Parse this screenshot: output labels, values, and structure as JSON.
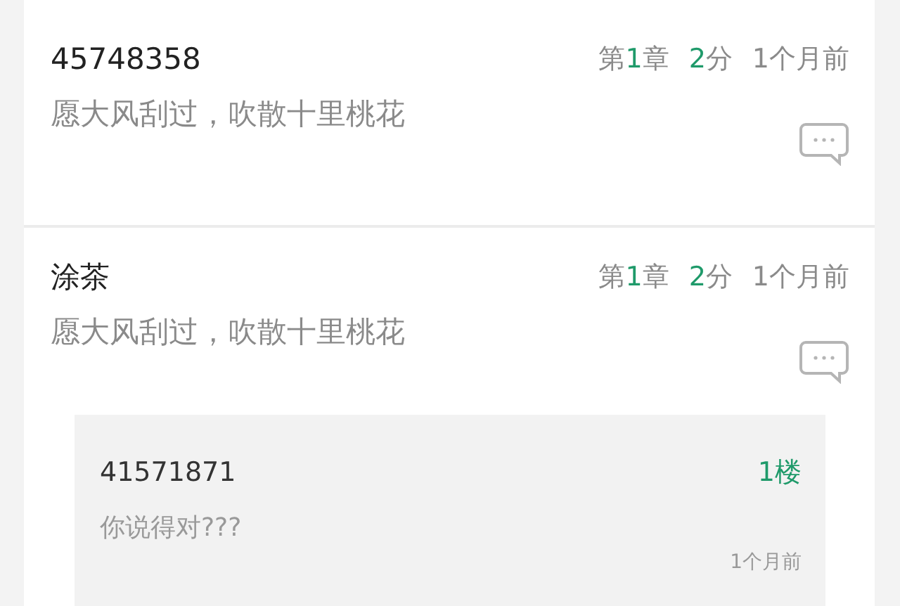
{
  "comments": [
    {
      "user": "45748358",
      "chapter": {
        "before": "第",
        "number": "1",
        "after": "章"
      },
      "score": {
        "number": "2",
        "after": "分"
      },
      "time": "1个月前",
      "content": "愿大风刮过，吹散十里桃花"
    },
    {
      "user": "涂茶",
      "chapter": {
        "before": "第",
        "number": "1",
        "after": "章"
      },
      "score": {
        "number": "2",
        "after": "分"
      },
      "time": "1个月前",
      "content": "愿大风刮过，吹散十里桃花",
      "replies": [
        {
          "user": "41571871",
          "floor": "1楼",
          "content": "你说得对???",
          "time": "1个月前"
        }
      ]
    }
  ]
}
